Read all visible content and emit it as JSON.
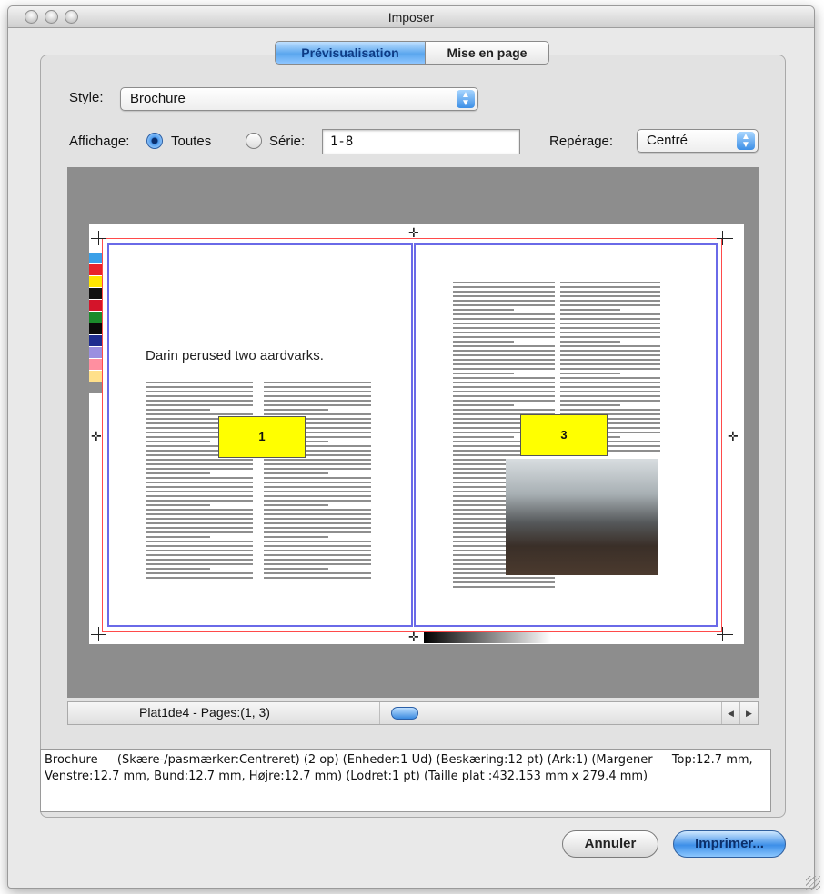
{
  "window": {
    "title": "Imposer"
  },
  "tabs": [
    {
      "label": "Prévisualisation",
      "active": true
    },
    {
      "label": "Mise en page",
      "active": false
    }
  ],
  "form": {
    "style_label": "Style:",
    "style_value": "Brochure",
    "display_label": "Affichage:",
    "option_all": "Toutes",
    "option_series": "Série:",
    "series_value": "1-8",
    "registration_label": "Repérage:",
    "registration_value": "Centré"
  },
  "preview": {
    "left_headline": "Darin perused two aardvarks.",
    "page_left": "1",
    "page_right": "3",
    "color_swatches": [
      "#3aa0e8",
      "#e8232a",
      "#ffe600",
      "#111111",
      "#d4142a",
      "#1a8a2b",
      "#0a0a0a",
      "#1d2c8f",
      "#9a8fe0",
      "#ff8fa0",
      "#ffe08a",
      "#8e8e8e"
    ]
  },
  "status": {
    "text": "Plat1de4 - Pages:(1, 3)",
    "scroll_left": "◀",
    "scroll_right": "▶"
  },
  "summary": "Brochure — (Skære-/pasmærker:Centreret) (2 op) (Enheder:1 Ud) (Beskæring:12 pt) (Ark:1) (Margener — Top:12.7 mm, Venstre:12.7 mm, Bund:12.7 mm, Højre:12.7 mm) (Lodret:1 pt) (Taille plat :432.153 mm x 279.4 mm)",
  "buttons": {
    "cancel": "Annuler",
    "print": "Imprimer..."
  },
  "colors": {
    "accent": "#3d8fe8",
    "page_marker": "#ffff00",
    "bleed_line": "#ff4a4a",
    "trim_line": "#6a6ae8"
  }
}
